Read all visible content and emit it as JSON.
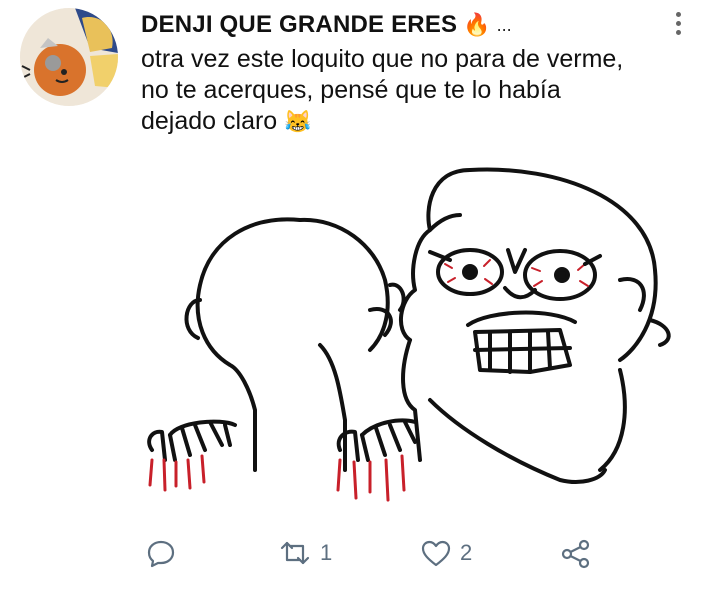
{
  "post": {
    "author": "DENJI QUE GRANDE ERES",
    "author_emoji": "🔥",
    "author_ellipsis": "...",
    "text_line_1": "otra vez este loquito que no para de verme,",
    "text_line_2": "no te acerques, pensé que te lo había",
    "text_line_3": "dejado claro",
    "text_emoji": "😹"
  },
  "actions": {
    "reply_count": "",
    "repost_count": "1",
    "like_count": "2"
  },
  "icons": [
    "avatar",
    "fire-icon",
    "more-options-icon",
    "reply-icon",
    "repost-icon",
    "like-icon",
    "share-icon"
  ],
  "colors": {
    "icon": "#5d6f80",
    "text": "#111111",
    "blood": "#c8202a"
  }
}
